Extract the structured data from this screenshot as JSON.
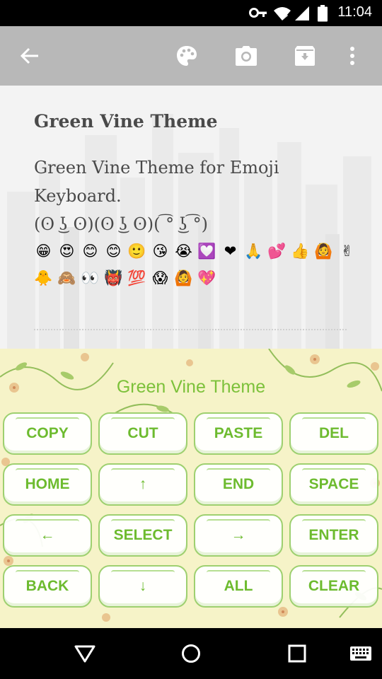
{
  "status_bar": {
    "time": "11:04",
    "icons": [
      "key-icon",
      "wifi-icon",
      "cell-signal-icon",
      "battery-icon"
    ]
  },
  "toolbar": {
    "background": "#b8b8b8",
    "actions": [
      "back-arrow-icon",
      "palette-icon",
      "camera-icon",
      "archive-icon",
      "more-vert-icon"
    ]
  },
  "note": {
    "title": "Green Vine Theme",
    "body_line1": "Green Vine Theme for Emoji",
    "body_line2": "Keyboard.",
    "kaomoji": "(ʘ ͜ʖ ʘ)(ʘ ͜ʖ ʘ)( ͡° ͜ʖ ͡°)",
    "emoji_row1": [
      "😁",
      "😍",
      "😊",
      "😊",
      "🙂",
      "😘",
      "😭",
      "💟",
      "❤",
      "🙏",
      "💕",
      "👍",
      "🙆",
      "✌"
    ],
    "emoji_row2": [
      "🐥",
      "🙈",
      "👀",
      "👹",
      "💯",
      "😱",
      "🙆",
      "💖"
    ]
  },
  "keyboard": {
    "title": "Green Vine Theme",
    "accent_color": "#6dbb2f",
    "rows": [
      [
        "COPY",
        "CUT",
        "PASTE",
        "DEL"
      ],
      [
        "HOME",
        "↑",
        "END",
        "SPACE"
      ],
      [
        "←",
        "SELECT",
        "→",
        "ENTER"
      ],
      [
        "BACK",
        "↓",
        "ALL",
        "CLEAR"
      ]
    ]
  },
  "nav_bar": {
    "buttons": [
      "back-triangle-icon",
      "home-circle-icon",
      "recents-square-icon",
      "keyboard-icon"
    ]
  }
}
